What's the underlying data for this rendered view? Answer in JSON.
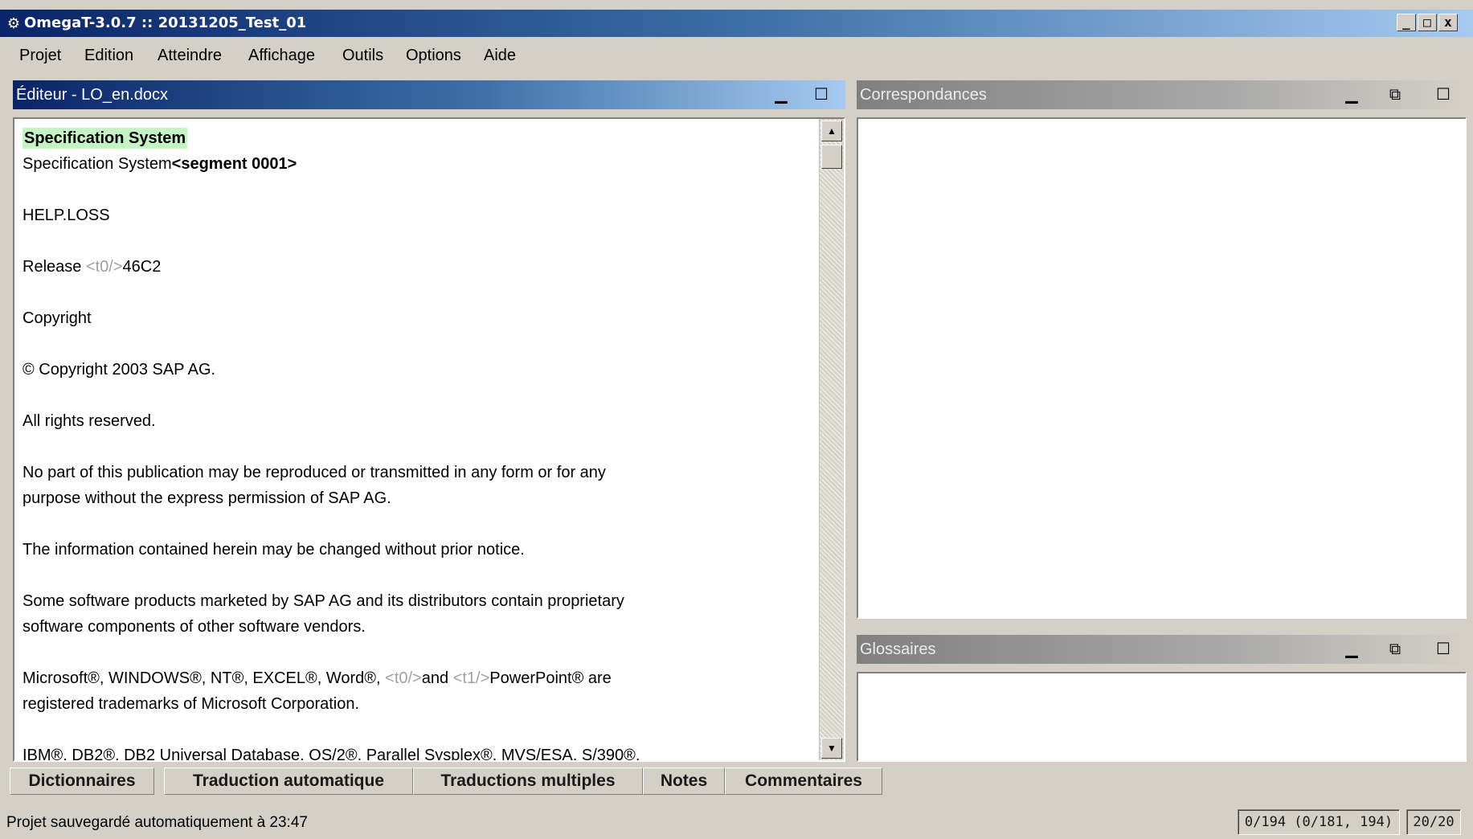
{
  "window": {
    "title": "OmegaT-3.0.7 :: 20131205_Test_01",
    "controls": [
      "_",
      "□",
      "x"
    ]
  },
  "menu": [
    "Projet",
    "Edition",
    "Atteindre",
    "Affichage",
    "Outils",
    "Options",
    "Aide"
  ],
  "editor": {
    "title": "Éditeur - LO_en.docx",
    "segments": [
      {
        "kind": "active_source",
        "text": "Specification System"
      },
      {
        "kind": "active_target",
        "text": "Specification System",
        "marker": "<segment 0001>"
      },
      {
        "kind": "plain",
        "lines": [
          "HELP.LOSS"
        ]
      },
      {
        "kind": "tagged",
        "parts": [
          "Release ",
          "<t0/>",
          "46C2"
        ]
      },
      {
        "kind": "plain",
        "lines": [
          "Copyright"
        ]
      },
      {
        "kind": "plain",
        "lines": [
          "© Copyright 2003 SAP AG."
        ]
      },
      {
        "kind": "plain",
        "lines": [
          "All rights reserved."
        ]
      },
      {
        "kind": "plain",
        "lines": [
          "No part of this publication may be reproduced or transmitted in any form or for any",
          "purpose without the express permission of SAP AG."
        ]
      },
      {
        "kind": "plain",
        "lines": [
          "The information contained herein may be changed without prior notice."
        ]
      },
      {
        "kind": "plain",
        "lines": [
          "Some software products marketed by SAP AG and its distributors contain proprietary",
          "software components of other software vendors."
        ]
      },
      {
        "kind": "tagged",
        "parts": [
          "Microsoft®, WINDOWS®, NT®, EXCEL®, Word®, ",
          "<t0/>",
          "and ",
          "<t1/>",
          "PowerPoint® are"
        ],
        "continuation": "registered trademarks of Microsoft Corporation."
      },
      {
        "kind": "plain",
        "lines": [
          "IBM®, DB2®, DB2 Universal Database, OS/2®, Parallel Sysplex®, MVS/ESA, S/390®,"
        ]
      }
    ]
  },
  "matches_pane": {
    "title": "Correspondances"
  },
  "glossary_pane": {
    "title": "Glossaires"
  },
  "tabs": [
    "Dictionnaires",
    "Traduction automatique",
    "Traductions multiples",
    "Notes",
    "Commentaires"
  ],
  "status": {
    "message": "Projet sauvegardé automatiquement à 23:47",
    "progress": "0/194 (0/181, 194)",
    "segment_count": "20/20"
  }
}
